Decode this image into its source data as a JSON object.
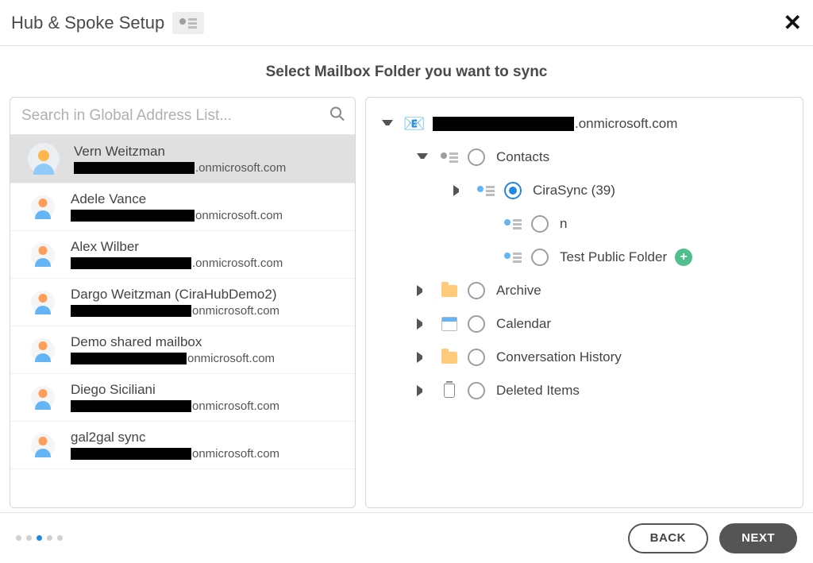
{
  "header": {
    "title": "Hub & Spoke Setup"
  },
  "subtitle": "Select Mailbox Folder you want to sync",
  "search": {
    "placeholder": "Search in Global Address List..."
  },
  "users": [
    {
      "name": "Vern Weitzman",
      "email_suffix": ".onmicrosoft.com",
      "redact_w": 152,
      "selected": true,
      "big": true
    },
    {
      "name": "Adele Vance",
      "email_suffix": "onmicrosoft.com",
      "redact_w": 156,
      "selected": false,
      "big": false
    },
    {
      "name": "Alex Wilber",
      "email_suffix": ".onmicrosoft.com",
      "redact_w": 152,
      "selected": false,
      "big": false
    },
    {
      "name": "Dargo Weitzman (CiraHubDemo2)",
      "email_suffix": "onmicrosoft.com",
      "redact_w": 152,
      "selected": false,
      "big": false
    },
    {
      "name": "Demo shared mailbox",
      "email_suffix": "onmicrosoft.com",
      "redact_w": 146,
      "selected": false,
      "big": false
    },
    {
      "name": "Diego Siciliani",
      "email_suffix": "onmicrosoft.com",
      "redact_w": 152,
      "selected": false,
      "big": false
    },
    {
      "name": "gal2gal sync",
      "email_suffix": "onmicrosoft.com",
      "redact_w": 152,
      "selected": false,
      "big": false
    }
  ],
  "tree": {
    "root_suffix": ".onmicrosoft.com",
    "contacts": {
      "label": "Contacts",
      "children": [
        {
          "label": "CiraSync (39)",
          "selected": true,
          "expandable": true
        },
        {
          "label": "n",
          "selected": false,
          "expandable": false
        },
        {
          "label": "Test Public Folder",
          "selected": false,
          "expandable": false,
          "add": true
        }
      ]
    },
    "siblings": [
      {
        "label": "Archive",
        "icon": "folder"
      },
      {
        "label": "Calendar",
        "icon": "calendar"
      },
      {
        "label": "Conversation History",
        "icon": "folder"
      },
      {
        "label": "Deleted Items",
        "icon": "trash"
      }
    ]
  },
  "footer": {
    "back": "BACK",
    "next": "NEXT",
    "step_active": 2,
    "step_count": 5
  }
}
